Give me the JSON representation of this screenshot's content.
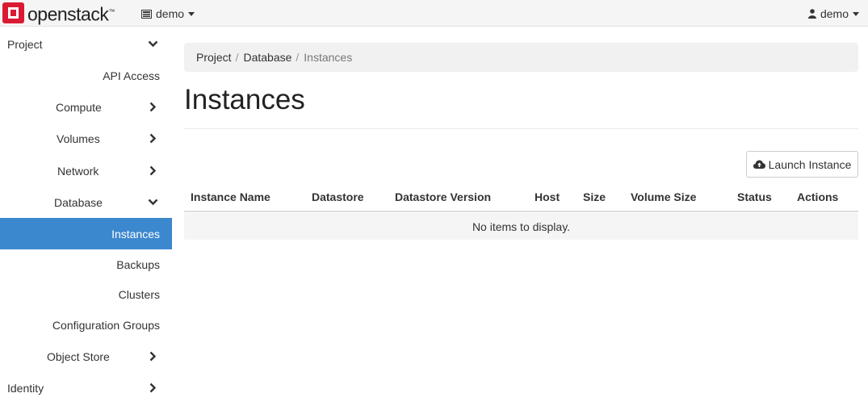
{
  "navbar": {
    "brand": "openstack",
    "brand_mark": "™",
    "project": "demo",
    "user": "demo"
  },
  "sidebar": {
    "items": [
      {
        "label": "Project",
        "chevron": "down"
      },
      {
        "label": "API Access"
      },
      {
        "label": "Compute",
        "chevron": "right"
      },
      {
        "label": "Volumes",
        "chevron": "right"
      },
      {
        "label": "Network",
        "chevron": "right"
      },
      {
        "label": "Database",
        "chevron": "down"
      },
      {
        "label": "Instances",
        "active": true
      },
      {
        "label": "Backups"
      },
      {
        "label": "Clusters"
      },
      {
        "label": "Configuration Groups"
      },
      {
        "label": "Object Store",
        "chevron": "right"
      },
      {
        "label": "Identity",
        "chevron": "right"
      }
    ]
  },
  "breadcrumb": {
    "items": [
      "Project",
      "Database"
    ],
    "current": "Instances",
    "separator": "/"
  },
  "page": {
    "title": "Instances",
    "launch_button": "Launch Instance"
  },
  "table": {
    "columns": [
      "Instance Name",
      "Datastore",
      "Datastore Version",
      "Host",
      "Size",
      "Volume Size",
      "Status",
      "Actions"
    ],
    "empty_message": "No items to display."
  },
  "colors": {
    "accent": "#3c88cf",
    "brand_red": "#da1a32",
    "navbar_bg": "#f5f5f5"
  },
  "icons": {
    "project_switch": "server-icon",
    "user": "user-icon",
    "launch": "cloud-upload-icon"
  }
}
